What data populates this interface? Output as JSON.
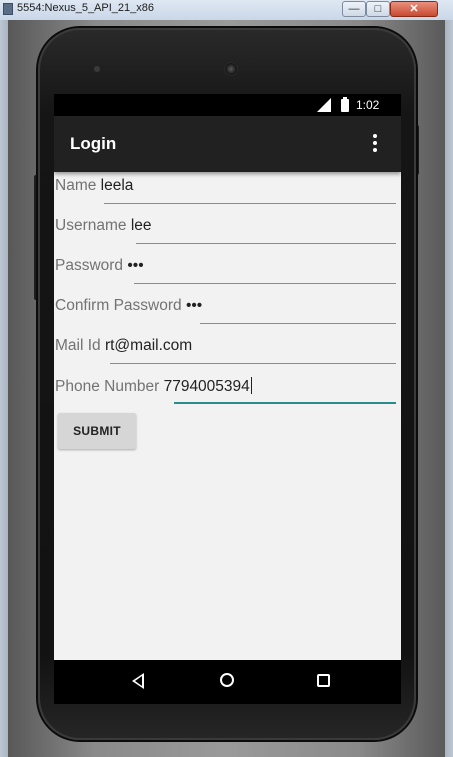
{
  "window": {
    "title": "5554:Nexus_5_API_21_x86",
    "minimize": "—",
    "maximize": "□",
    "close": "✕"
  },
  "statusbar": {
    "network": "3G",
    "time": "1:02"
  },
  "appbar": {
    "title": "Login",
    "menu_icon": "more-vert-icon"
  },
  "form": {
    "fields": [
      {
        "label": "Name",
        "value": "leela"
      },
      {
        "label": "Username",
        "value": "lee"
      },
      {
        "label": "Password",
        "value": "•••"
      },
      {
        "label": "Confirm Password",
        "value": "•••"
      },
      {
        "label": "Mail Id",
        "value": "rt@mail.com"
      },
      {
        "label": "Phone Number",
        "value": "7794005394"
      }
    ],
    "submit_label": "SUBMIT",
    "focus_color": "#2a8c8a"
  },
  "navbar": {
    "back_icon": "back-icon",
    "home_icon": "home-icon",
    "recents_icon": "recents-icon"
  }
}
